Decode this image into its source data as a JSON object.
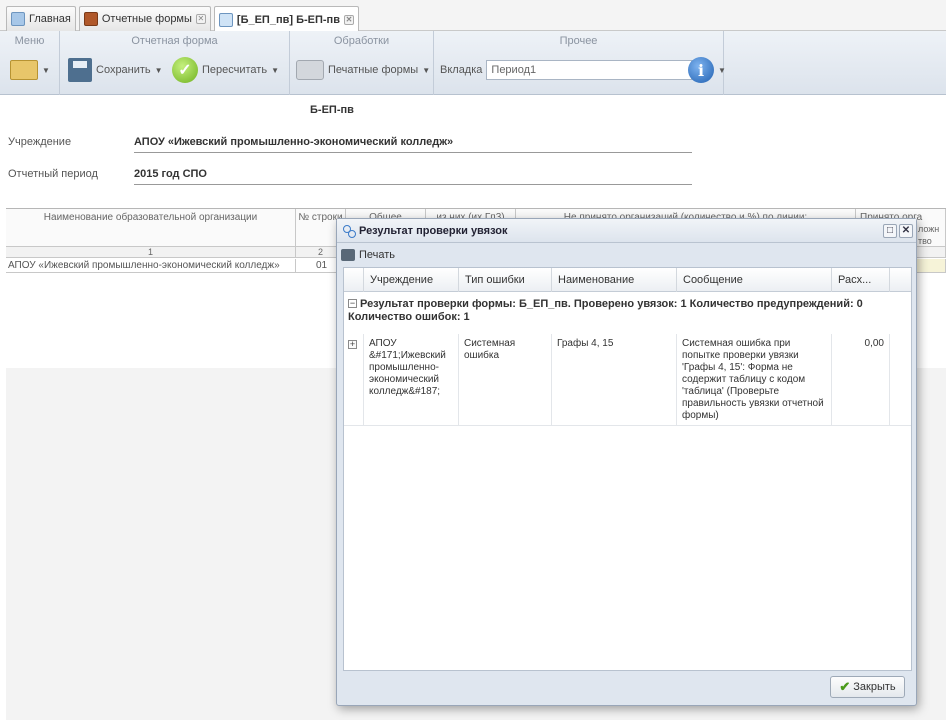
{
  "tabs": [
    {
      "label": "Главная",
      "closable": false,
      "active": false
    },
    {
      "label": "Отчетные формы",
      "closable": true,
      "active": false
    },
    {
      "label": "[Б_ЕП_пв] Б-ЕП-пв",
      "closable": true,
      "active": true
    }
  ],
  "ribbon": {
    "menu_title": "Меню",
    "report_form_title": "Отчетная форма",
    "save_label": "Сохранить",
    "recalc_label": "Пересчитать",
    "processing_title": "Обработки",
    "print_forms_label": "Печатные формы",
    "other_title": "Прочее",
    "tab_label": "Вкладка",
    "tab_value": "Период1"
  },
  "form": {
    "code": "Б-ЕП-пв",
    "institution_label": "Учреждение",
    "institution_value": "АПОУ «Ижевский промышленно-экономический колледж»",
    "period_label": "Отчетный период",
    "period_value": "2015 год СПО"
  },
  "grid": {
    "headers": [
      "Наименование образовательной организации",
      "№ строки",
      "Общее",
      "из них (их Гп3)",
      "Не принято организаций (количество и %) по линии:",
      "Принято орга"
    ],
    "subheaders": [
      "ложн",
      "тво"
    ],
    "numbers": [
      "1",
      "2"
    ],
    "row": {
      "name": "АПОУ «Ижевский промышленно-экономический колледж»",
      "line": "01"
    }
  },
  "modal": {
    "title": "Результат проверки увязок",
    "print_label": "Печать",
    "columns": [
      "Учреждение",
      "Тип ошибки",
      "Наименование",
      "Сообщение",
      "Расх..."
    ],
    "group_text": "Результат проверки формы: Б_ЕП_пв. Проверено увязок: 1 Количество предупреждений: 0 Количество ошибок: 1",
    "row": {
      "institution": "АПОУ &#171;Ижевский промышленно-экономический колледж&#187;",
      "error_type": "Системная ошибка",
      "name": "Графы 4, 15",
      "message": "Системная ошибка при попытке проверки увязки 'Графы 4, 15': Форма не содержит таблицу с кодом 'таблица' (Проверьте правильность увязки отчетной формы)",
      "diff": "0,00"
    },
    "close_label": "Закрыть"
  },
  "colors": {
    "accent": "#3a7ac8",
    "ribbon": "#dce3ec",
    "success": "#6fb11f"
  }
}
